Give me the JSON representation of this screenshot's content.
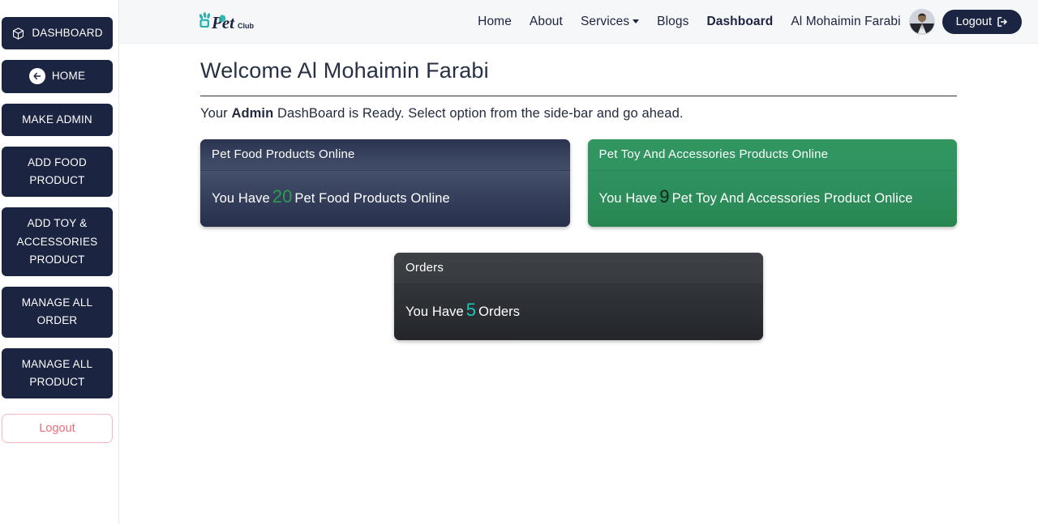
{
  "sidebar": {
    "items": [
      {
        "label": "DASHBOARD",
        "icon": "cube-icon",
        "name": "sidebar-item-dashboard"
      },
      {
        "label": "HOME",
        "icon": "arrow-left-circle-icon",
        "name": "sidebar-item-home"
      },
      {
        "label": "MAKE ADMIN",
        "icon": "",
        "name": "sidebar-item-make-admin"
      },
      {
        "label": "ADD FOOD PRODUCT",
        "icon": "",
        "name": "sidebar-item-add-food-product"
      },
      {
        "label": "ADD TOY & ACCESSORIES PRODUCT",
        "icon": "",
        "name": "sidebar-item-add-toy-accessories-product"
      },
      {
        "label": "MANAGE ALL ORDER",
        "icon": "",
        "name": "sidebar-item-manage-all-order"
      },
      {
        "label": "MANAGE ALL PRODUCT",
        "icon": "",
        "name": "sidebar-item-manage-all-product"
      }
    ],
    "logout_label": "Logout"
  },
  "navbar": {
    "brand": {
      "name": "Pet",
      "sub": "Club"
    },
    "links": [
      {
        "label": "Home",
        "active": false
      },
      {
        "label": "About",
        "active": false
      },
      {
        "label": "Services",
        "active": false,
        "has_caret": true
      },
      {
        "label": "Blogs",
        "active": false
      },
      {
        "label": "Dashboard",
        "active": true
      }
    ],
    "user_name": "Al Mohaimin Farabi",
    "avatar_icon": "user-avatar",
    "logout_label": "Logout",
    "logout_icon": "sign-out-icon"
  },
  "main": {
    "welcome_title": "Welcome Al Mohaimin Farabi",
    "subtitle_pre": "Your ",
    "subtitle_bold": "Admin",
    "subtitle_post": " DashBoard is Ready. Select option from the side-bar and go ahead."
  },
  "cards": {
    "food": {
      "header": "Pet Food Products Online",
      "text_pre": "You Have",
      "count": "20",
      "text_post": "Pet Food Products Online",
      "accent": "#2c9c4e"
    },
    "toys": {
      "header": "Pet Toy And Accessories Products Online",
      "text_pre": "You Have",
      "count": "9",
      "text_post": "Pet Toy And Accessories Product Onlice",
      "accent": "#14241b"
    },
    "orders": {
      "header": "Orders",
      "text_pre": "You Have",
      "count": "5",
      "text_post": "Orders",
      "accent": "#1ec5b6"
    }
  },
  "colors": {
    "navy": "#1b2440",
    "navbar_bg": "#f6f7f9",
    "logout_outline": "#ec6e7c",
    "card_blue": "#2c3550",
    "card_green": "#2a8d5a",
    "card_dark": "#2c2f35"
  }
}
